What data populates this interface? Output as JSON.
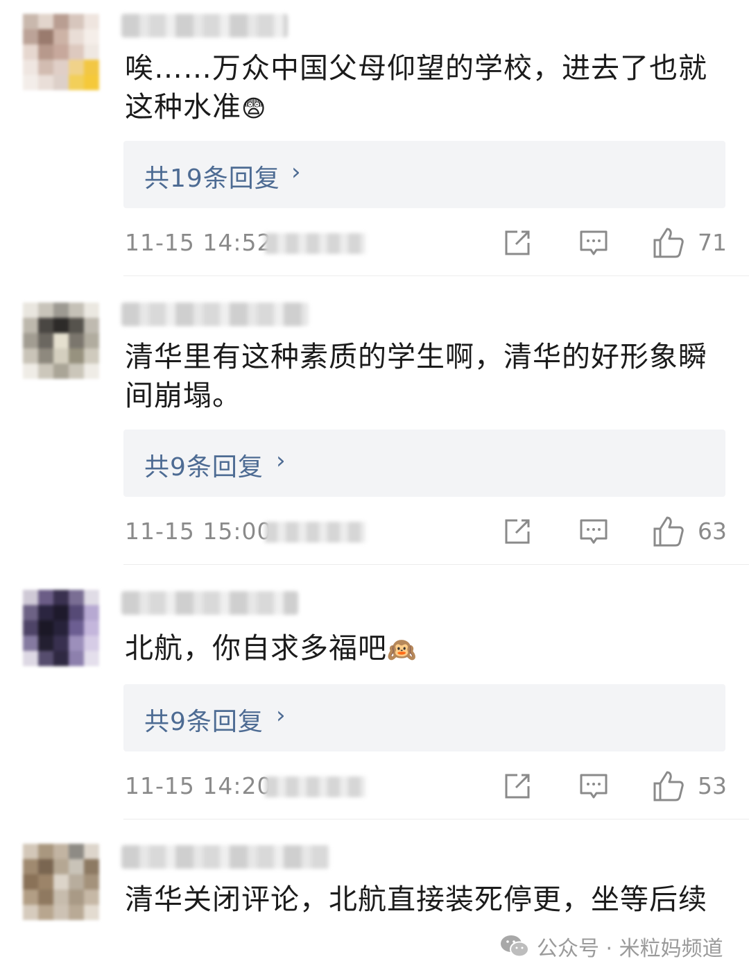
{
  "comments": [
    {
      "text": "唉……万众中国父母仰望的学校，进去了也就这种水准",
      "emoji": "😨",
      "reply_label": "共19条回复",
      "time": "11-15 14:52",
      "likes": "71"
    },
    {
      "text": "清华里有这种素质的学生啊，清华的好形象瞬间崩塌。",
      "emoji": "",
      "reply_label": "共9条回复",
      "time": "11-15 15:00",
      "likes": "63"
    },
    {
      "text": "北航，你自求多福吧",
      "emoji": "🙉",
      "reply_label": "共9条回复",
      "time": "11-15 14:20",
      "likes": "53"
    },
    {
      "text": "清华关闭评论，北航直接装死停更，坐等后续",
      "emoji": ""
    }
  ],
  "icons": {
    "chevron": "chevron-right-icon",
    "share": "share-icon",
    "comment": "comment-icon",
    "like": "thumbs-up-icon"
  },
  "watermark": {
    "text": "公众号 · 米粒妈频道",
    "icon": "wechat-icon"
  },
  "colors": {
    "reply_link": "#4d6b93",
    "meta_gray": "#8a8a8a",
    "reply_bg": "#f3f4f6"
  }
}
